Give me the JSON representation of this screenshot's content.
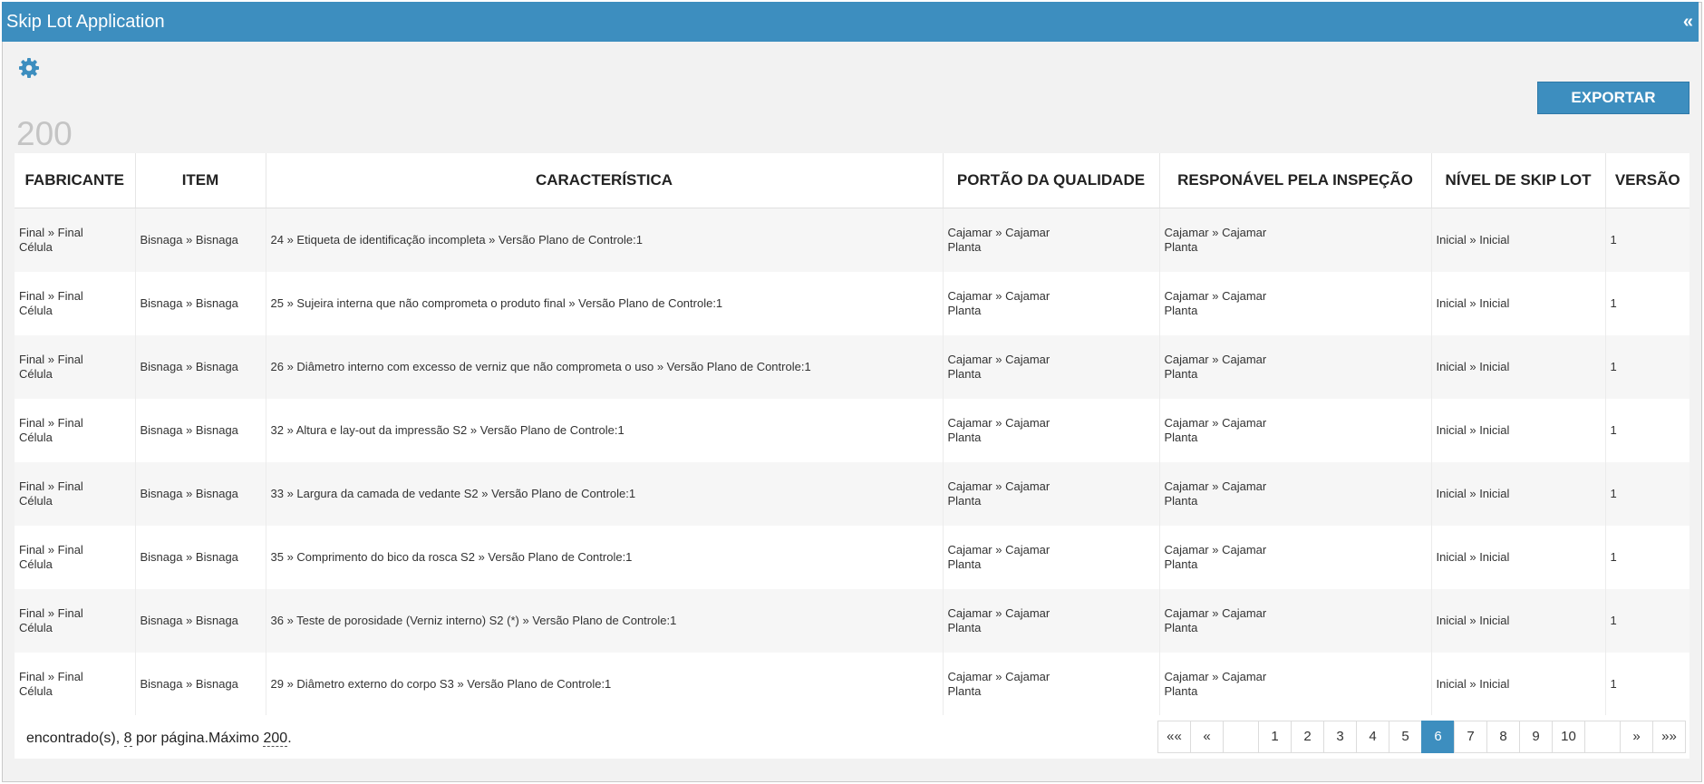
{
  "window": {
    "title": "Skip Lot Application",
    "collapse_label": "«"
  },
  "toolbar": {
    "export_label": "EXPORTAR"
  },
  "result_count": "200",
  "table": {
    "columns": [
      "FABRICANTE",
      "ITEM",
      "CARACTERÍSTICA",
      "PORTÃO DA QUALIDADE",
      "RESPONÁVEL PELA INSPEÇÃO",
      "NÍVEL DE SKIP LOT",
      "VERSÃO"
    ],
    "rows": [
      {
        "fabricante": [
          "Final » Final",
          "Célula"
        ],
        "item": "Bisnaga » Bisnaga",
        "caracteristica": "24 » Etiqueta de identificação incompleta » Versão Plano de Controle:1",
        "portao": [
          "Cajamar » Cajamar",
          "Planta"
        ],
        "responsavel": [
          "Cajamar » Cajamar",
          "Planta"
        ],
        "nivel": "Inicial » Inicial",
        "versao": "1"
      },
      {
        "fabricante": [
          "Final » Final",
          "Célula"
        ],
        "item": "Bisnaga » Bisnaga",
        "caracteristica": "25 » Sujeira interna que não comprometa o produto final » Versão Plano de Controle:1",
        "portao": [
          "Cajamar » Cajamar",
          "Planta"
        ],
        "responsavel": [
          "Cajamar » Cajamar",
          "Planta"
        ],
        "nivel": "Inicial » Inicial",
        "versao": "1"
      },
      {
        "fabricante": [
          "Final » Final",
          "Célula"
        ],
        "item": "Bisnaga » Bisnaga",
        "caracteristica": "26 » Diâmetro interno com excesso de verniz que não comprometa o uso » Versão Plano de Controle:1",
        "portao": [
          "Cajamar » Cajamar",
          "Planta"
        ],
        "responsavel": [
          "Cajamar » Cajamar",
          "Planta"
        ],
        "nivel": "Inicial » Inicial",
        "versao": "1"
      },
      {
        "fabricante": [
          "Final » Final",
          "Célula"
        ],
        "item": "Bisnaga » Bisnaga",
        "caracteristica": "32 » Altura e lay-out da impressão S2 » Versão Plano de Controle:1",
        "portao": [
          "Cajamar » Cajamar",
          "Planta"
        ],
        "responsavel": [
          "Cajamar » Cajamar",
          "Planta"
        ],
        "nivel": "Inicial » Inicial",
        "versao": "1"
      },
      {
        "fabricante": [
          "Final » Final",
          "Célula"
        ],
        "item": "Bisnaga » Bisnaga",
        "caracteristica": "33 » Largura da camada de vedante S2 » Versão Plano de Controle:1",
        "portao": [
          "Cajamar » Cajamar",
          "Planta"
        ],
        "responsavel": [
          "Cajamar » Cajamar",
          "Planta"
        ],
        "nivel": "Inicial » Inicial",
        "versao": "1"
      },
      {
        "fabricante": [
          "Final » Final",
          "Célula"
        ],
        "item": "Bisnaga » Bisnaga",
        "caracteristica": "35 » Comprimento do bico da rosca S2 » Versão Plano de Controle:1",
        "portao": [
          "Cajamar » Cajamar",
          "Planta"
        ],
        "responsavel": [
          "Cajamar » Cajamar",
          "Planta"
        ],
        "nivel": "Inicial » Inicial",
        "versao": "1"
      },
      {
        "fabricante": [
          "Final » Final",
          "Célula"
        ],
        "item": "Bisnaga » Bisnaga",
        "caracteristica": "36 » Teste de porosidade (Verniz interno) S2 (*) » Versão Plano de Controle:1",
        "portao": [
          "Cajamar » Cajamar",
          "Planta"
        ],
        "responsavel": [
          "Cajamar » Cajamar",
          "Planta"
        ],
        "nivel": "Inicial » Inicial",
        "versao": "1"
      },
      {
        "fabricante": [
          "Final » Final",
          "Célula"
        ],
        "item": "Bisnaga » Bisnaga",
        "caracteristica": "29 » Diâmetro externo do corpo S3 » Versão Plano de Controle:1",
        "portao": [
          "Cajamar » Cajamar",
          "Planta"
        ],
        "responsavel": [
          "Cajamar » Cajamar",
          "Planta"
        ],
        "nivel": "Inicial » Inicial",
        "versao": "1"
      }
    ]
  },
  "footer": {
    "summary_prefix": "encontrado(s), ",
    "per_page": "8",
    "summary_mid": " por página.Máximo ",
    "max": "200",
    "summary_suffix": "."
  },
  "pagination": {
    "first": "««",
    "prev": "«",
    "pages": [
      "1",
      "2",
      "3",
      "4",
      "5",
      "6",
      "7",
      "8",
      "9",
      "10"
    ],
    "active_page": "6",
    "next": "»",
    "last": "»»"
  },
  "colors": {
    "accent": "#3d8ebf",
    "background": "#f2f2f2",
    "row_alt": "#f6f6f6",
    "count_text": "#c4c4c4"
  },
  "icons": {
    "settings": "gear-icon"
  }
}
